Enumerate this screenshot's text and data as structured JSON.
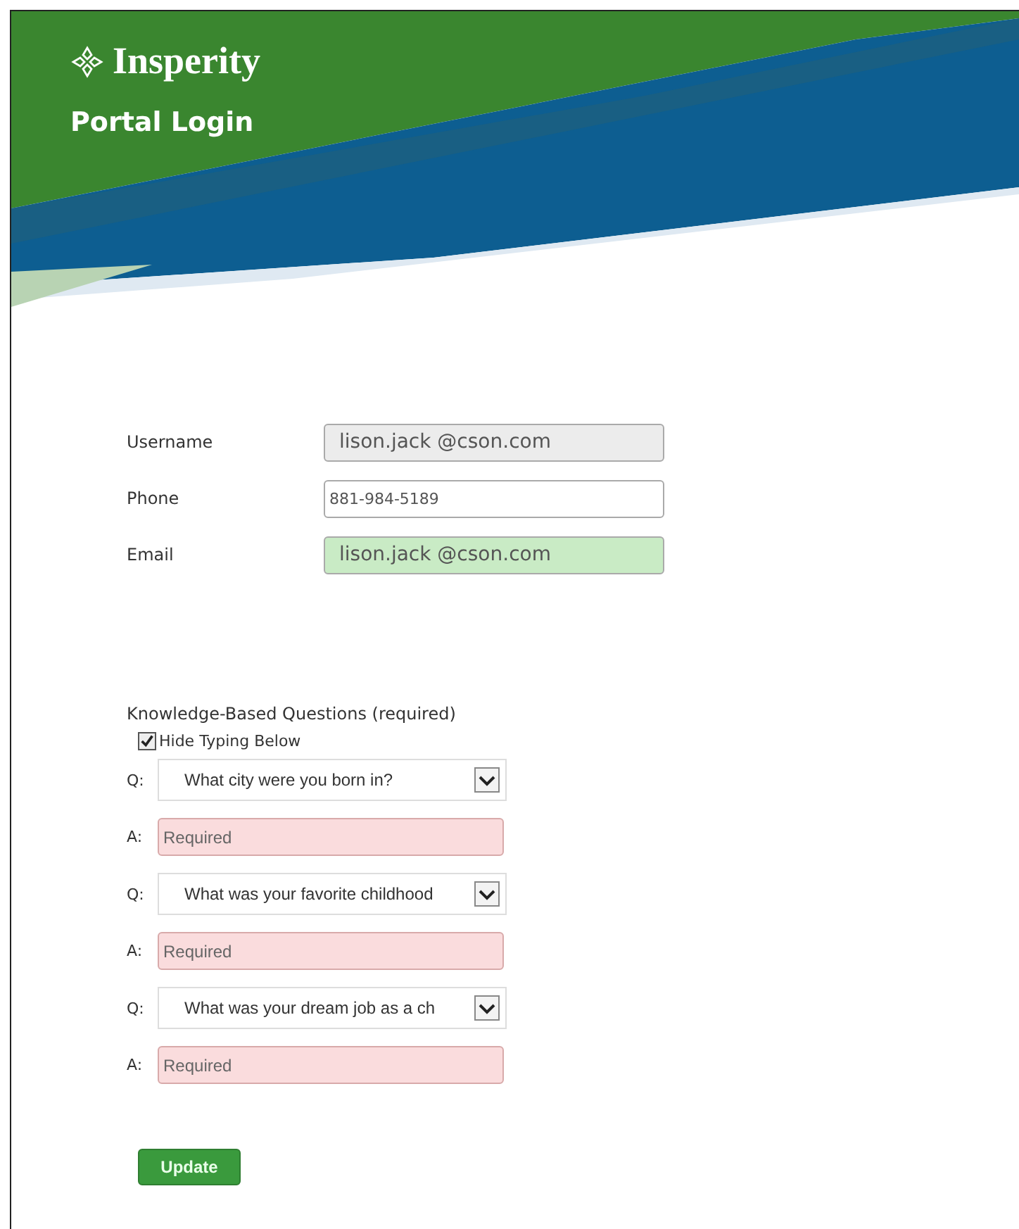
{
  "header": {
    "brand": "Insperity",
    "title": "Portal Login"
  },
  "fields": [
    {
      "label": "Username",
      "value": "lison.jack @cson.com",
      "disabled": true,
      "valid": false
    },
    {
      "label": "Phone",
      "value": "881-984-5189",
      "disabled": false,
      "valid": false
    },
    {
      "label": "Email",
      "value": "lison.jack @cson.com",
      "disabled": false,
      "valid": true
    }
  ],
  "questions_section": {
    "heading": "Knowledge-Based Questions (required)",
    "hide_typing": {
      "label": "Hide Typing Below",
      "checked": true
    },
    "items": [
      {
        "q_label": "Q:",
        "question": "What city were you born in?",
        "a_label": "A:",
        "placeholder": "Required",
        "invalid": true
      },
      {
        "q_label": "Q:",
        "question": "What was your favorite childhood",
        "a_label": "A:",
        "placeholder": "Required",
        "invalid": true
      },
      {
        "q_label": "Q:",
        "question": "What was your dream job as a ch",
        "a_label": "A:",
        "placeholder": "Required",
        "invalid": true
      }
    ]
  },
  "button": "Update"
}
